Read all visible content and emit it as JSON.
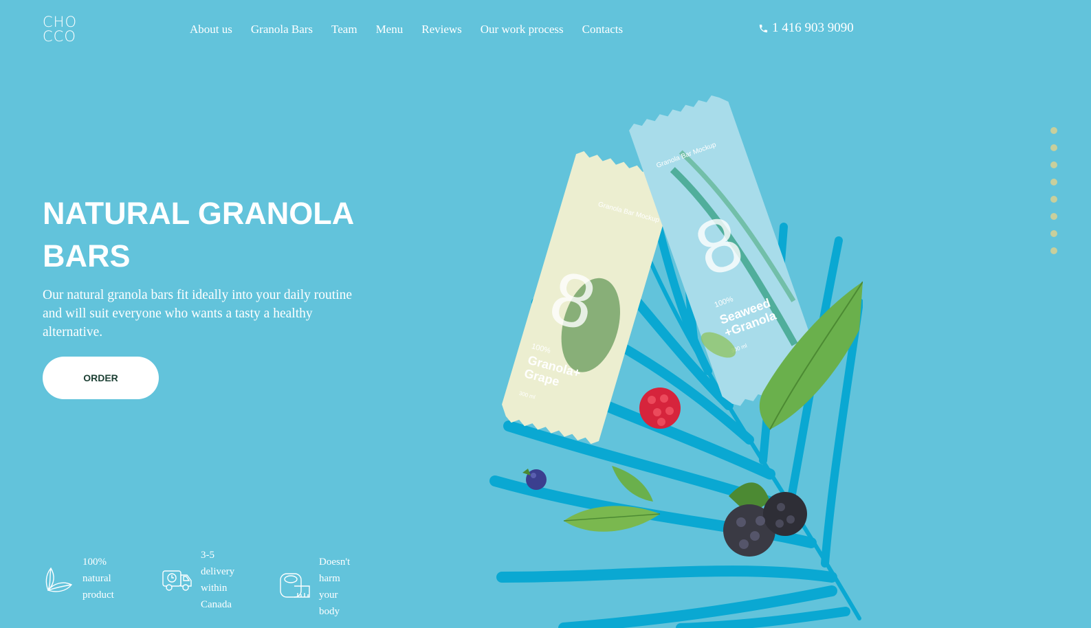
{
  "header": {
    "logo_line1": "CHO",
    "logo_line2": "CCO",
    "nav": [
      "About us",
      "Granola Bars",
      "Team",
      "Menu",
      "Reviews",
      "Our work process",
      "Contacts"
    ],
    "phone": "1 416 903 9090",
    "phone_icon": "phone-icon"
  },
  "hero": {
    "title_line1": "NATURAL GRANOLA",
    "title_line2": "BARS",
    "description": "Our natural granola bars fit ideally into your daily routine and will suit everyone who wants a tasty a healthy alternative.",
    "order_label": "ORDER"
  },
  "product_image": {
    "bar1_label_small": "Granola Bar Mockup",
    "bar1_number": "8",
    "bar1_percent": "100%",
    "bar1_name_line1": "Granola+",
    "bar1_name_line2": "Grape",
    "bar1_volume": "300 ml",
    "bar2_label_small": "Granola Bar Mockup",
    "bar2_number": "8",
    "bar2_percent": "100%",
    "bar2_name_line1": "Seaweed",
    "bar2_name_line2": "+Granola",
    "bar2_volume": "300 ml"
  },
  "features": [
    {
      "icon": "leaf-icon",
      "text_lines": [
        "100% natural",
        "product"
      ]
    },
    {
      "icon": "delivery-truck-icon",
      "text_lines": [
        "3-5 delivery",
        "within",
        "Canada"
      ]
    },
    {
      "icon": "measuring-tape-icon",
      "text_lines": [
        "Doesn't harm",
        "your body"
      ]
    }
  ],
  "pagination": {
    "count": 8
  },
  "colors": {
    "background": "#62c3db",
    "accent_dark": "#1d4034",
    "dot": "#c8cf9c",
    "palm": "#0aa8d2"
  }
}
